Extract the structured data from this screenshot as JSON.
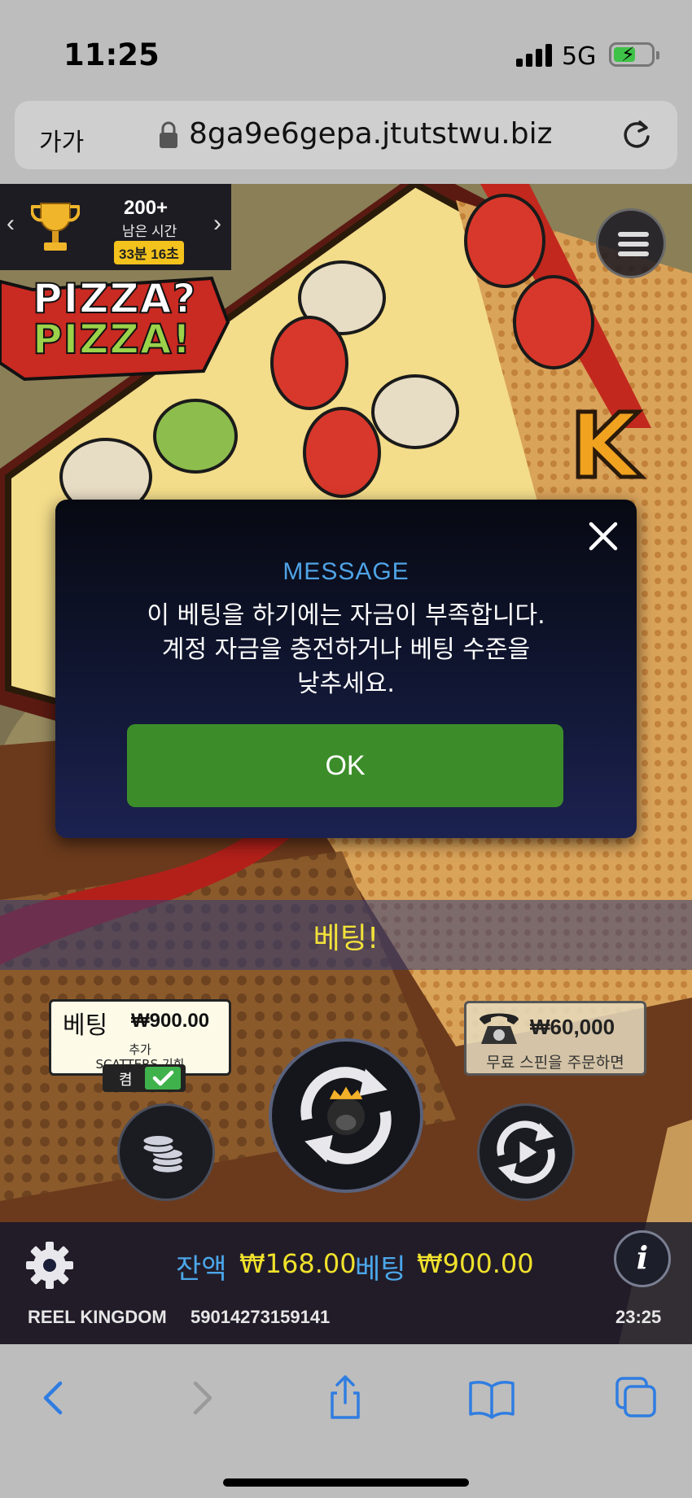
{
  "status_bar": {
    "time": "11:25",
    "network": "5G"
  },
  "browser": {
    "text_size_label": "가가",
    "url": "8ga9e6gepa.jtutstwu.biz"
  },
  "tournament": {
    "count": "200+",
    "label": "남은 시간",
    "time_left": "33분 16초"
  },
  "logo": {
    "line1": "PIZZA?",
    "line2": "PIZZA!"
  },
  "modal": {
    "title": "MESSAGE",
    "lines": [
      "이 베팅을 하기에는 자금이 부족합니다.",
      "계정 자금을 충전하거나 베팅 수준을",
      "낮추세요."
    ],
    "ok_label": "OK"
  },
  "bet_strip": {
    "label": "베팅!"
  },
  "bet_card": {
    "title": "베팅",
    "value": "₩900.00",
    "line1": "추가",
    "line2": "SCATTERS 기회",
    "toggle_label": "켬"
  },
  "buy_card": {
    "value": "₩60,000",
    "label": "무료 스핀을 주문하면"
  },
  "info_bar": {
    "balance_label": "잔액",
    "balance_value": "₩168.00",
    "bet_label": "베팅",
    "bet_value": "₩900.00",
    "provider": "REEL KINGDOM",
    "round_id": "59014273159141",
    "clock": "23:25"
  },
  "colors": {
    "accent_blue": "#4fa3e6",
    "ok_green": "#3c8d2a",
    "yellow": "#f0e12c"
  }
}
